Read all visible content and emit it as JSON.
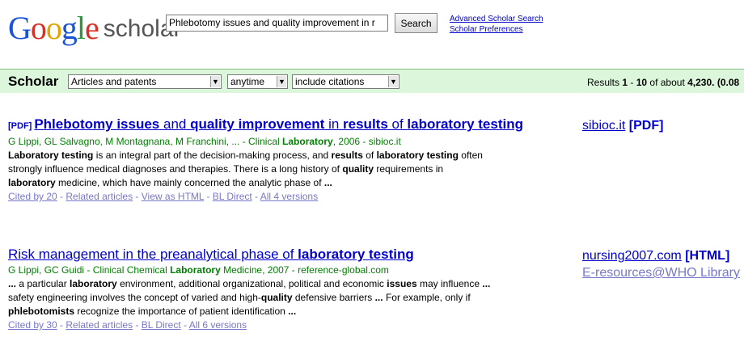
{
  "logo": {
    "google": "Google",
    "scholar": "scholar"
  },
  "search": {
    "value": "Phlebotomy issues and quality improvement in r",
    "button": "Search"
  },
  "header_links": {
    "advanced": "Advanced Scholar Search",
    "preferences": "Scholar Preferences"
  },
  "bar": {
    "title": "Scholar",
    "articles": "Articles and patents",
    "time": "anytime",
    "citations": "include citations",
    "results_prefix": "Results ",
    "range_start": "1",
    "range_sep": " - ",
    "range_end": "10",
    "of_about": " of about ",
    "total": "4,230",
    "time_info": ". (0.08"
  },
  "results": [
    {
      "pdf_tag": "[PDF]",
      "title": [
        {
          "t": "Phlebotomy issues",
          "b": true
        },
        {
          "t": " and ",
          "b": false
        },
        {
          "t": "quality improvement",
          "b": true
        },
        {
          "t": " in ",
          "b": false
        },
        {
          "t": "results",
          "b": true
        },
        {
          "t": " of ",
          "b": false
        },
        {
          "t": "laboratory testing",
          "b": true
        }
      ],
      "meta": [
        {
          "t": "G Lippi, GL Salvagno, M Montagnana, M Franchini, ... - Clinical ",
          "b": false
        },
        {
          "t": "Laboratory",
          "b": true
        },
        {
          "t": ", 2006 - sibioc.it",
          "b": false
        }
      ],
      "snippet": [
        {
          "t": "Laboratory testing",
          "b": true
        },
        {
          "t": " is an integral part of the decision-making process, and ",
          "b": false
        },
        {
          "t": "results",
          "b": true
        },
        {
          "t": " of ",
          "b": false
        },
        {
          "t": "laboratory testing",
          "b": true
        },
        {
          "t": " often strongly influence medical diagnoses and therapies. There is a long history of ",
          "b": false
        },
        {
          "t": "quality",
          "b": true
        },
        {
          "t": " requirements in ",
          "b": false
        },
        {
          "t": "laboratory",
          "b": true
        },
        {
          "t": " medicine, which have mainly concerned the analytic phase of ",
          "b": false
        },
        {
          "t": "...",
          "b": true
        }
      ],
      "links": [
        "Cited by 20",
        "Related articles",
        "View as HTML",
        "BL Direct",
        "All 4 versions"
      ],
      "side": [
        {
          "link": "sibioc.it",
          "tag": "[PDF]"
        }
      ]
    },
    {
      "pdf_tag": "",
      "title": [
        {
          "t": "Risk management in the preanalytical phase of ",
          "b": false
        },
        {
          "t": "laboratory testing",
          "b": true
        }
      ],
      "meta": [
        {
          "t": "G Lippi, GC Guidi - Clinical Chemical ",
          "b": false
        },
        {
          "t": "Laboratory",
          "b": true
        },
        {
          "t": " Medicine, 2007 - reference-global.com",
          "b": false
        }
      ],
      "snippet": [
        {
          "t": "...",
          "b": true
        },
        {
          "t": " a particular ",
          "b": false
        },
        {
          "t": "laboratory",
          "b": true
        },
        {
          "t": " environment, additional organizational, political and economic ",
          "b": false
        },
        {
          "t": "issues",
          "b": true
        },
        {
          "t": " may influence ",
          "b": false
        },
        {
          "t": "...",
          "b": true
        },
        {
          "t": " safety engineering involves the concept of varied and high-",
          "b": false
        },
        {
          "t": "quality",
          "b": true
        },
        {
          "t": " defensive barriers ",
          "b": false
        },
        {
          "t": "...",
          "b": true
        },
        {
          "t": " For example, only if ",
          "b": false
        },
        {
          "t": "phlebotomists",
          "b": true
        },
        {
          "t": " recognize the importance of patient identification ",
          "b": false
        },
        {
          "t": "...",
          "b": true
        }
      ],
      "links": [
        "Cited by 30",
        "Related articles",
        "BL Direct",
        "All 6 versions"
      ],
      "side": [
        {
          "link": "nursing2007.com",
          "tag": "[HTML]"
        },
        {
          "link": "E-resources@WHO Library",
          "tag": ""
        }
      ]
    }
  ]
}
